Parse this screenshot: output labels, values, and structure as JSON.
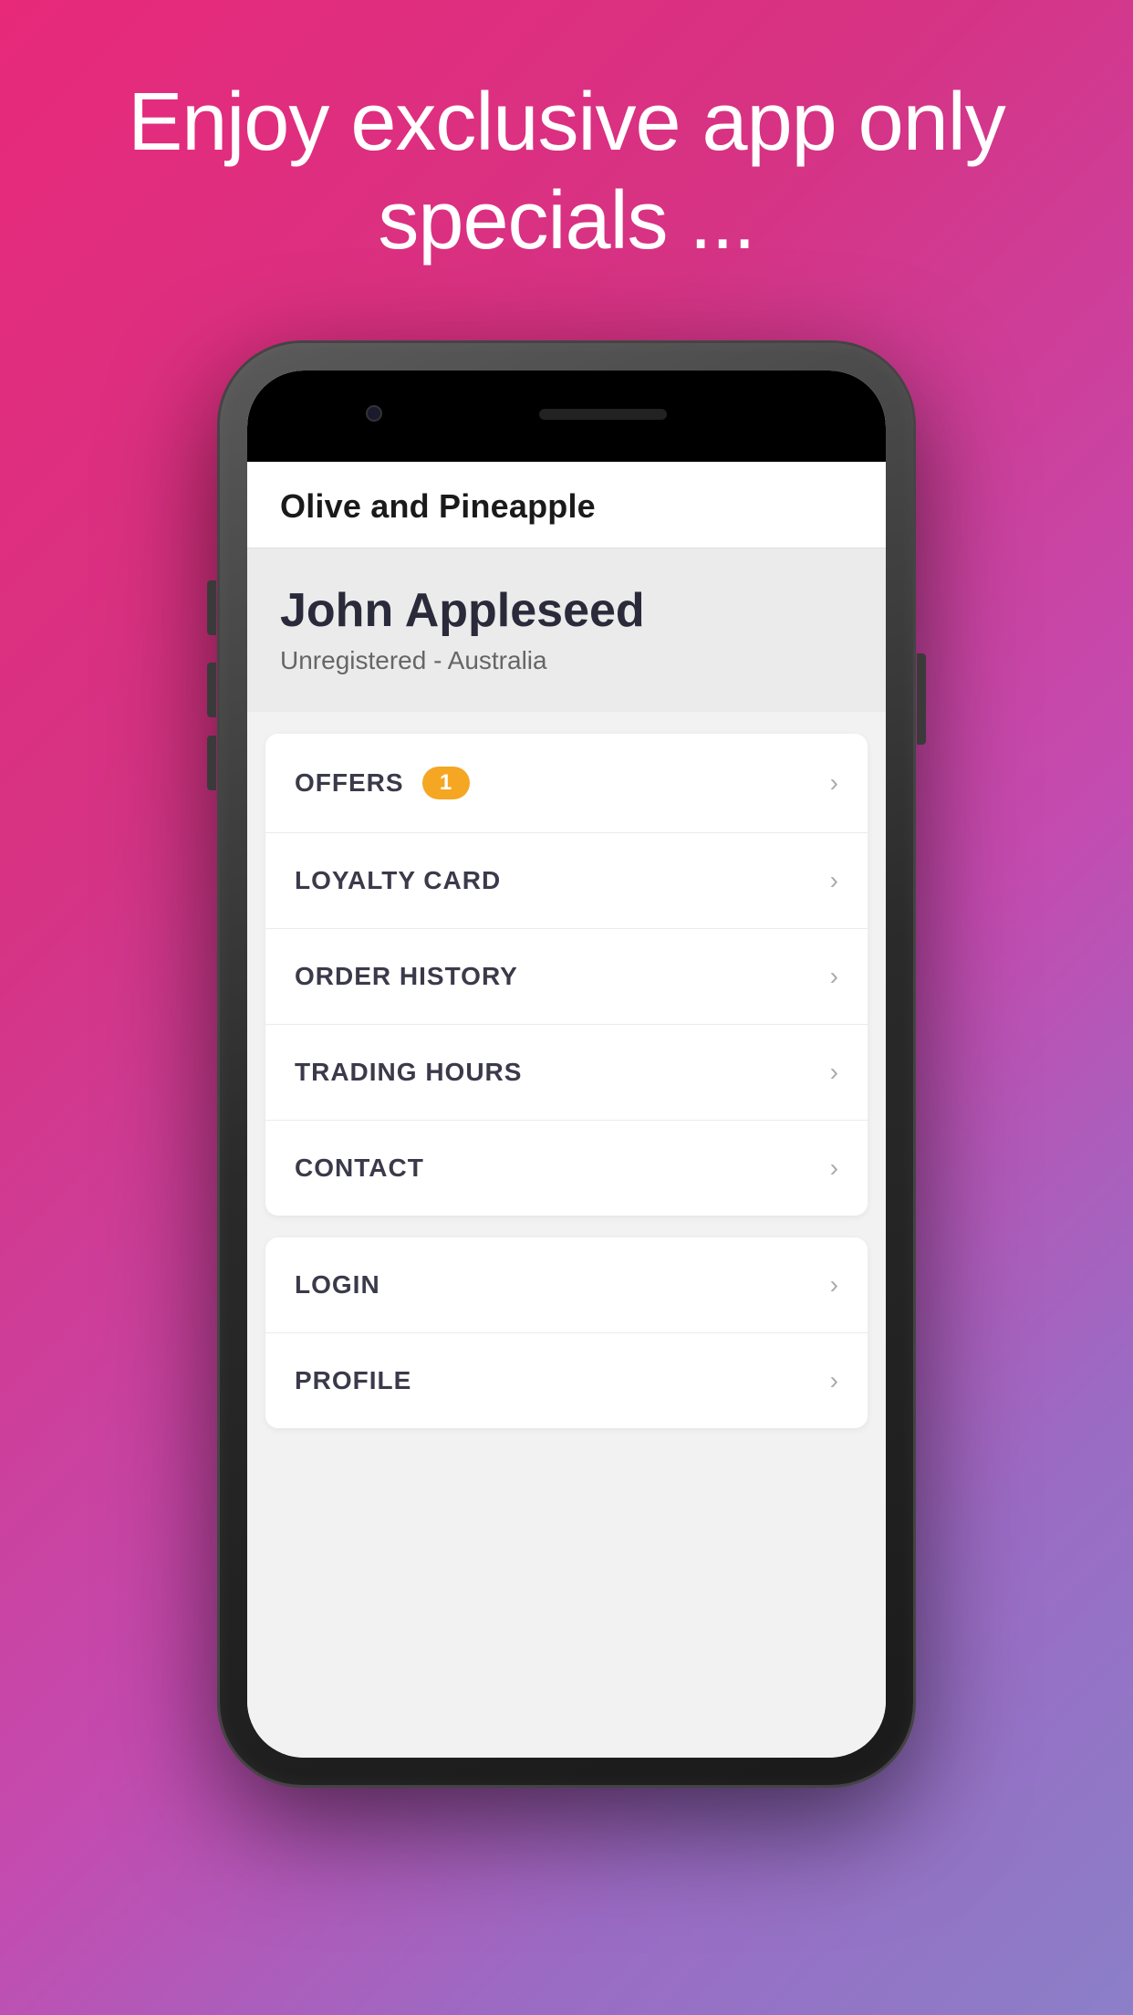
{
  "background": {
    "gradient_start": "#e8297a",
    "gradient_end": "#8b7fc8"
  },
  "tagline": "Enjoy exclusive app only specials ...",
  "app": {
    "title": "Olive and Pineapple",
    "user": {
      "name": "John Appleseed",
      "status": "Unregistered - Australia"
    },
    "menu_items_group1": [
      {
        "label": "OFFERS",
        "badge": "1",
        "has_badge": true
      },
      {
        "label": "LOYALTY CARD",
        "has_badge": false
      },
      {
        "label": "ORDER HISTORY",
        "has_badge": false
      },
      {
        "label": "TRADING HOURS",
        "has_badge": false
      },
      {
        "label": "CONTACT",
        "has_badge": false
      }
    ],
    "menu_items_group2": [
      {
        "label": "LOGIN",
        "has_badge": false
      },
      {
        "label": "PROFILE",
        "has_badge": false
      }
    ]
  }
}
